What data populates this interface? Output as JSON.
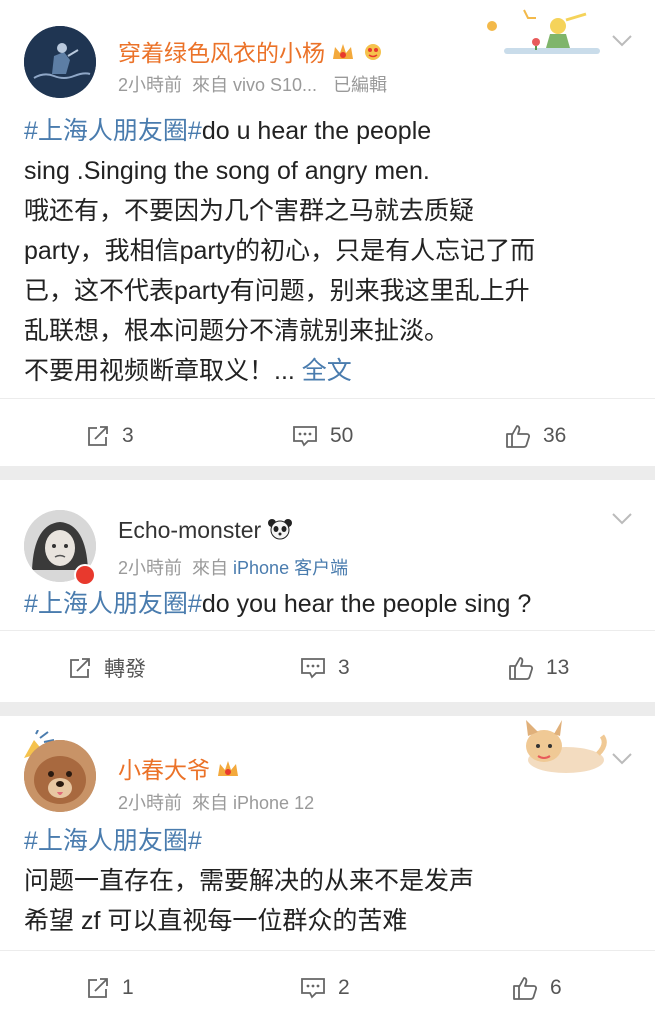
{
  "posts": [
    {
      "username": "穿着绿色风衣的小杨",
      "time": "2小時前",
      "source": "來自 vivo S10...",
      "edited": "已編輯",
      "hashtag": "#上海人朋友圈#",
      "lines": [
        "do u hear the people",
        "sing .Singing the song of angry men.",
        "哦还有，不要因为几个害群之马就去质疑",
        "party，我相信party的初心，只是有人忘记了而",
        "已，这不代表party有问题，别来我这里乱上升",
        "乱联想，根本问题分不清就别来扯淡。",
        "不要用视频断章取义！..."
      ],
      "more_label": "全文",
      "repost": "3",
      "comments": "50",
      "likes": "36"
    },
    {
      "username": "Echo-monster",
      "time": "2小時前",
      "source_prefix": "來自",
      "source": "iPhone 客户端",
      "hashtag": "#上海人朋友圈#",
      "lines": [
        "do you hear the people sing ?"
      ],
      "repost": "轉發",
      "comments": "3",
      "likes": "13"
    },
    {
      "username": "小春大爷",
      "time": "2小時前",
      "source": "來自 iPhone 12",
      "hashtag": "#上海人朋友圈#",
      "lines": [
        "问题一直存在，需要解决的从来不是发声",
        "希望 zf 可以直视每一位群众的苦难"
      ],
      "repost": "1",
      "comments": "2",
      "likes": "6"
    }
  ],
  "icons": {
    "repost": "repost-icon",
    "comment": "comment-icon",
    "like": "thumbs-up-icon",
    "chevron": "chevron-down-icon"
  },
  "colors": {
    "link": "#4a7cae",
    "vip_name": "#eb7228",
    "meta": "#9a9a9a"
  }
}
